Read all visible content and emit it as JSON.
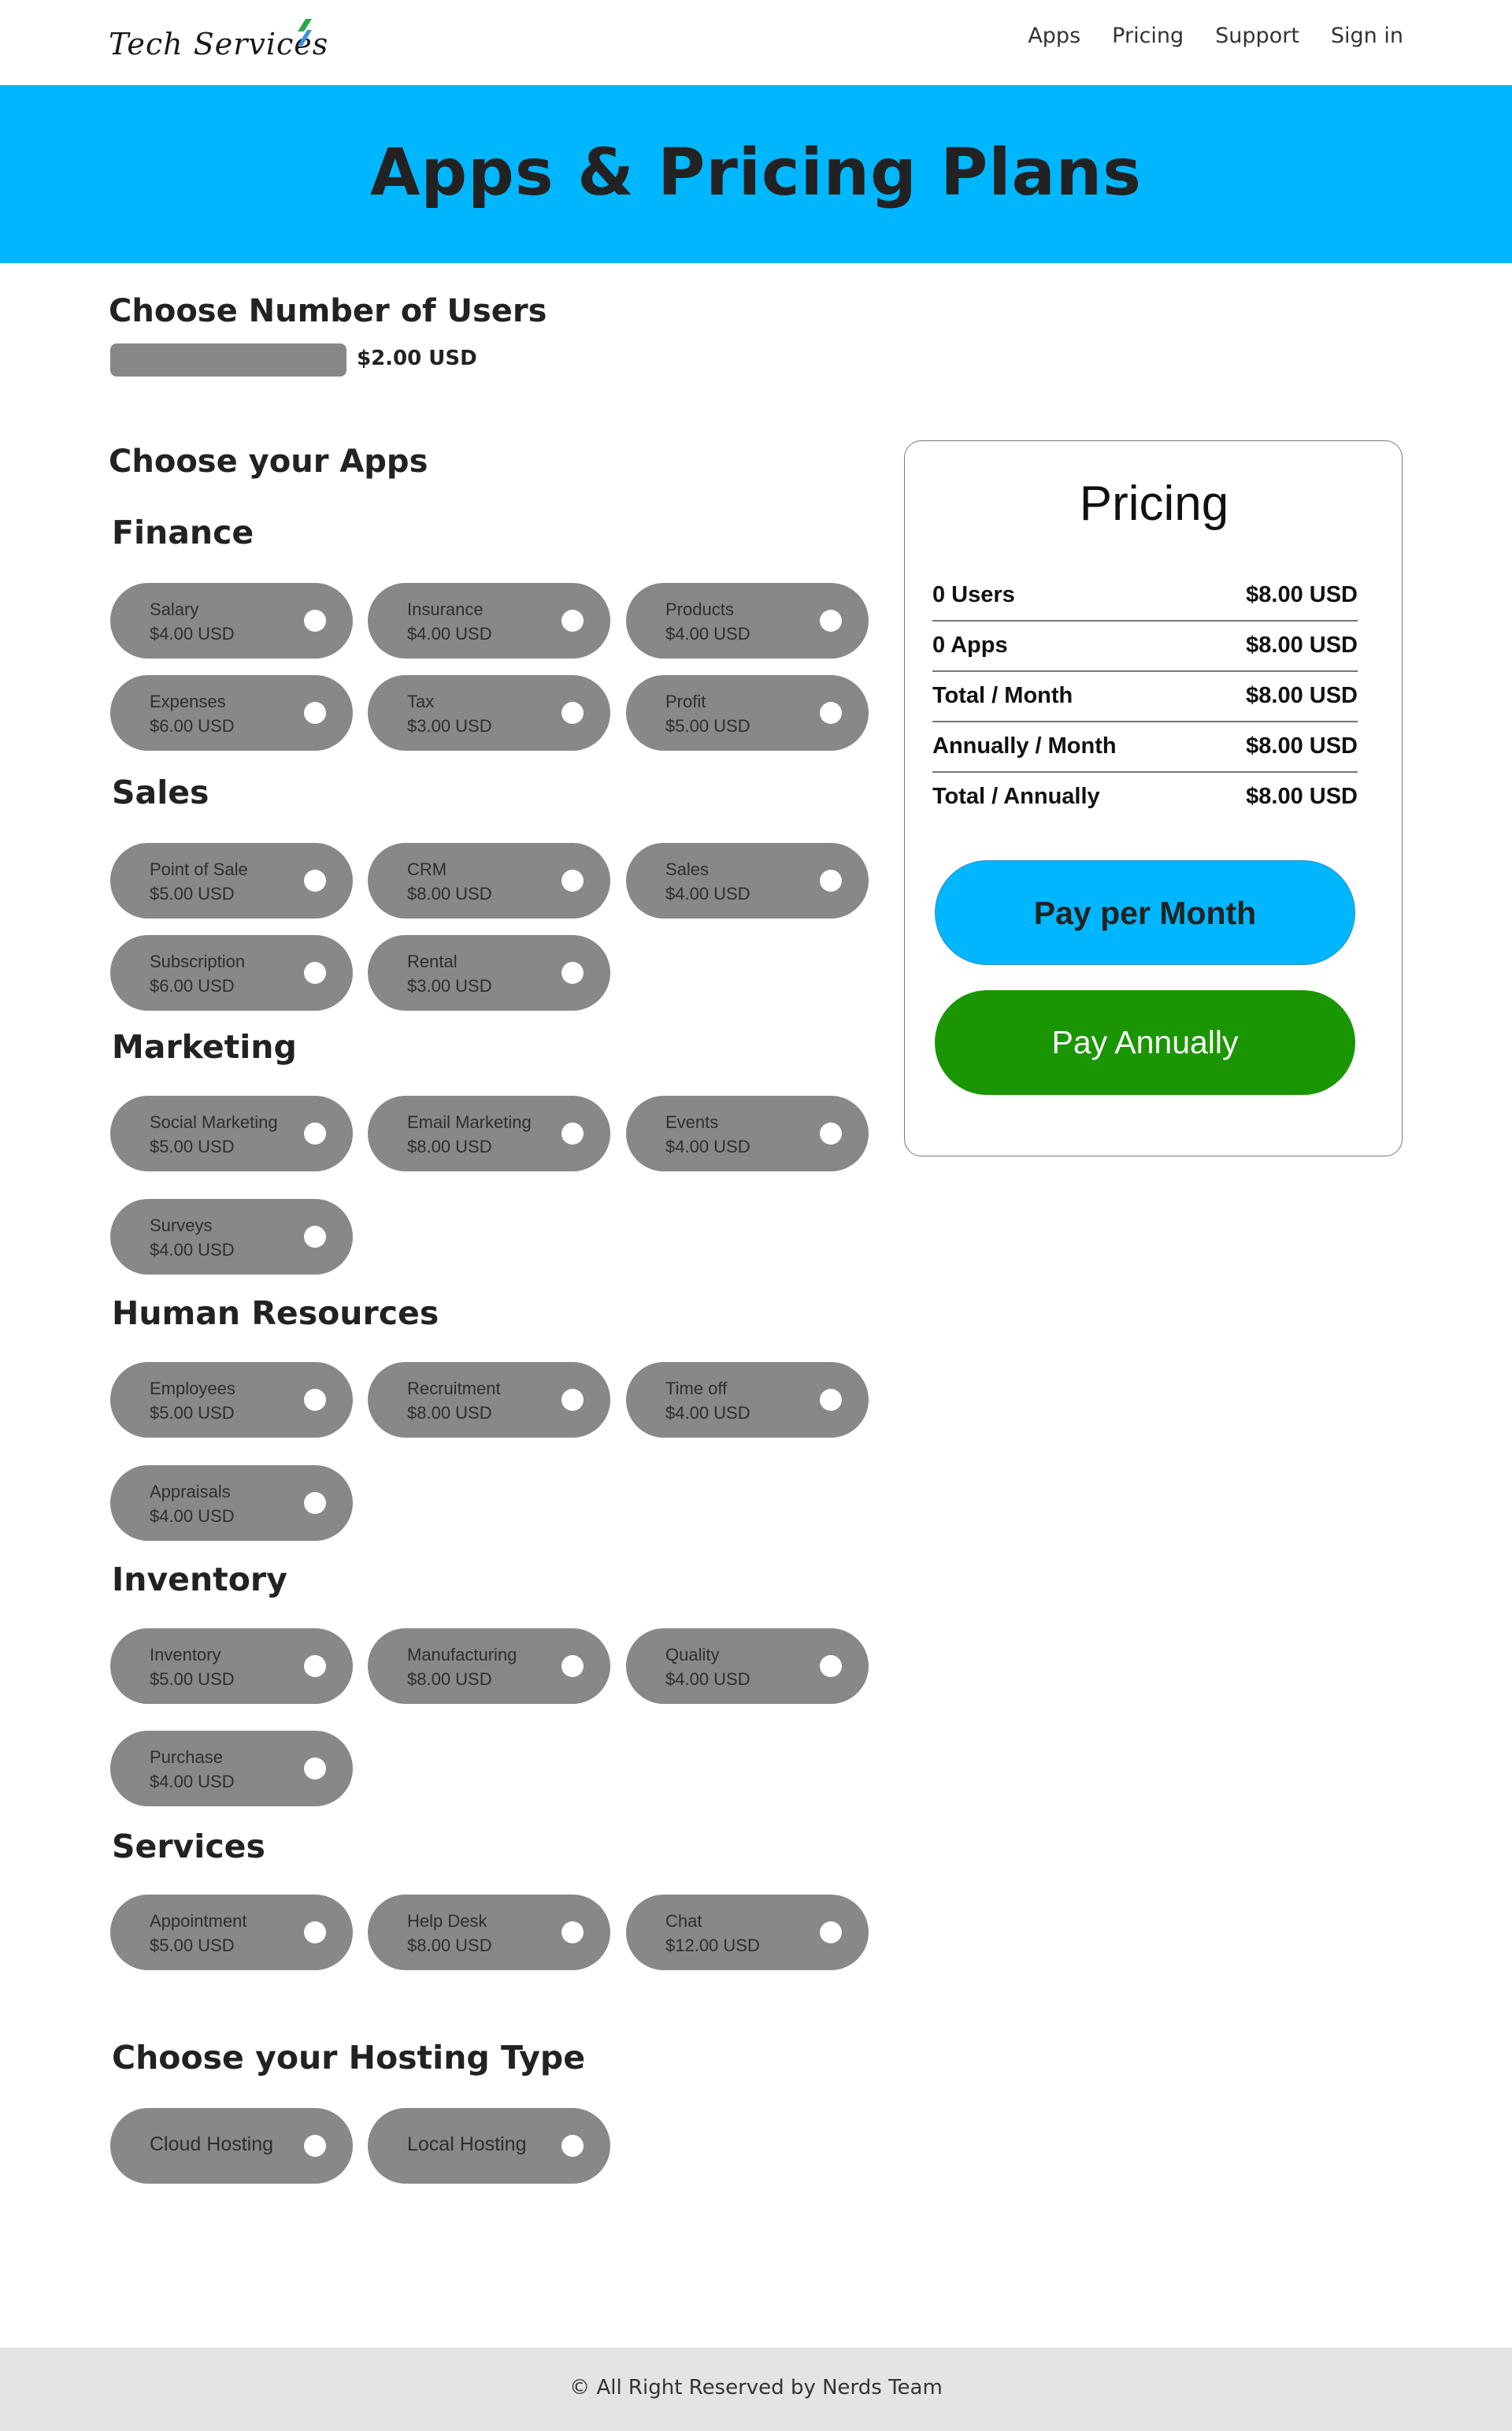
{
  "nav": {
    "brand": "Tech Services",
    "links": [
      "Apps",
      "Pricing",
      "Support",
      "Sign in"
    ]
  },
  "hero": {
    "title": "Apps & Pricing Plans"
  },
  "users": {
    "heading": "Choose Number of Users",
    "price": "$2.00 USD"
  },
  "apps": {
    "heading": "Choose your Apps",
    "categories": [
      {
        "name": "Finance",
        "items": [
          {
            "name": "Salary",
            "price": "$4.00 USD"
          },
          {
            "name": "Insurance",
            "price": "$4.00 USD"
          },
          {
            "name": "Products",
            "price": "$4.00 USD"
          },
          {
            "name": "Expenses",
            "price": "$6.00 USD"
          },
          {
            "name": "Tax",
            "price": "$3.00 USD"
          },
          {
            "name": "Profit",
            "price": "$5.00 USD"
          }
        ]
      },
      {
        "name": "Sales",
        "items": [
          {
            "name": "Point of Sale",
            "price": "$5.00 USD"
          },
          {
            "name": "CRM",
            "price": "$8.00 USD"
          },
          {
            "name": "Sales",
            "price": "$4.00 USD"
          },
          {
            "name": "Subscription",
            "price": "$6.00 USD"
          },
          {
            "name": "Rental",
            "price": "$3.00 USD"
          }
        ]
      },
      {
        "name": "Marketing",
        "items": [
          {
            "name": "Social Marketing",
            "price": "$5.00 USD"
          },
          {
            "name": "Email Marketing",
            "price": "$8.00 USD"
          },
          {
            "name": "Events",
            "price": "$4.00 USD"
          },
          {
            "name": "Surveys",
            "price": "$4.00 USD"
          }
        ]
      },
      {
        "name": "Human Resources",
        "items": [
          {
            "name": "Employees",
            "price": "$5.00 USD"
          },
          {
            "name": "Recruitment",
            "price": "$8.00 USD"
          },
          {
            "name": "Time off",
            "price": "$4.00 USD"
          },
          {
            "name": "Appraisals",
            "price": "$4.00 USD"
          }
        ]
      },
      {
        "name": "Inventory",
        "items": [
          {
            "name": "Inventory",
            "price": "$5.00 USD"
          },
          {
            "name": "Manufacturing",
            "price": "$8.00 USD"
          },
          {
            "name": "Quality",
            "price": "$4.00 USD"
          },
          {
            "name": "Purchase",
            "price": "$4.00 USD"
          }
        ]
      },
      {
        "name": "Services",
        "items": [
          {
            "name": "Appointment",
            "price": "$5.00 USD"
          },
          {
            "name": "Help Desk",
            "price": "$8.00 USD"
          },
          {
            "name": "Chat",
            "price": "$12.00 USD"
          }
        ]
      }
    ]
  },
  "hosting": {
    "heading": "Choose your Hosting Type",
    "options": [
      "Cloud Hosting",
      "Local Hosting"
    ]
  },
  "pricing": {
    "title": "Pricing",
    "rows": [
      {
        "label": "0 Users",
        "value": "$8.00 USD"
      },
      {
        "label": "0 Apps",
        "value": "$8.00 USD"
      },
      {
        "label": "Total / Month",
        "value": "$8.00 USD"
      },
      {
        "label": "Annually / Month",
        "value": "$8.00 USD"
      },
      {
        "label": "Total / Annually",
        "value": "$8.00 USD"
      }
    ],
    "pay_month": "Pay per Month",
    "pay_annual": "Pay Annually"
  },
  "footer": {
    "text": "All Right Reserved by Nerds Team",
    "copyright_symbol": "©"
  },
  "colors": {
    "accent": "#00b6ff",
    "annual": "#1a9602",
    "pill": "#888888",
    "footer_bg": "#e4e4e4"
  }
}
